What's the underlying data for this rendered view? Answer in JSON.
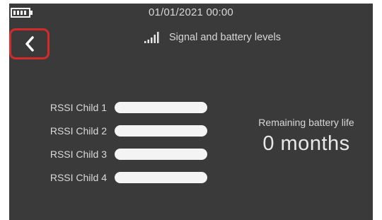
{
  "status_bar": {
    "battery_icon": "battery-icon",
    "datetime": "01/01/2021  00:00"
  },
  "header": {
    "back_icon": "chevron-left-icon",
    "signal_icon": "signal-bars-icon",
    "title": "Signal and battery levels"
  },
  "rssi": {
    "items": [
      {
        "label": "RSSI Child 1",
        "level": 0
      },
      {
        "label": "RSSI Child 2",
        "level": 0
      },
      {
        "label": "RSSI Child 3",
        "level": 0
      },
      {
        "label": "RSSI Child 4",
        "level": 0
      }
    ]
  },
  "battery": {
    "label": "Remaining battery life",
    "value": "0 months"
  },
  "colors": {
    "screen_background": "#3a3a3a",
    "back_button_highlight": "#d42a2a",
    "bar_background": "#f4f4f4"
  }
}
